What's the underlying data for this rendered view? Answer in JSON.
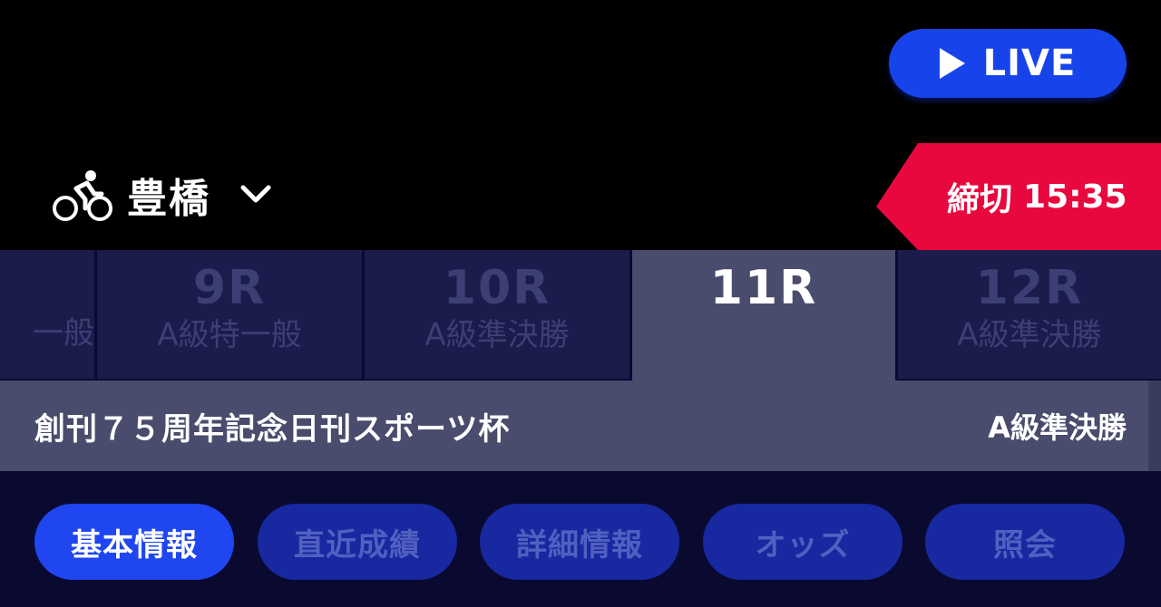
{
  "live_button": {
    "label": "LIVE",
    "icon": "play-icon"
  },
  "venue": {
    "name": "豊橋",
    "icon": "bicycle-icon",
    "dropdown_icon": "chevron-down-icon"
  },
  "deadline": {
    "label": "締切",
    "time": "15:35",
    "color": "#e8083e"
  },
  "race_tabs": [
    {
      "number": "",
      "class": "一般",
      "active": false
    },
    {
      "number": "9R",
      "class": "A級特一般",
      "active": false
    },
    {
      "number": "10R",
      "class": "A級準決勝",
      "active": false
    },
    {
      "number": "11R",
      "class": "",
      "active": true
    },
    {
      "number": "12R",
      "class": "A級準決勝",
      "active": false
    }
  ],
  "race_info": {
    "title": "創刊７５周年記念日刊スポーツ杯",
    "grade": "A級準決勝"
  },
  "info_tabs": [
    {
      "label": "基本情報",
      "active": true
    },
    {
      "label": "直近成績",
      "active": false
    },
    {
      "label": "詳細情報",
      "active": false
    },
    {
      "label": "オッズ",
      "active": false
    },
    {
      "label": "照会",
      "active": false
    }
  ],
  "colors": {
    "accent_blue": "#1744ea",
    "deadline_red": "#e8083e",
    "tab_active_bg": "#4a4c6d",
    "tab_inactive_bg": "#1b1c4b"
  }
}
